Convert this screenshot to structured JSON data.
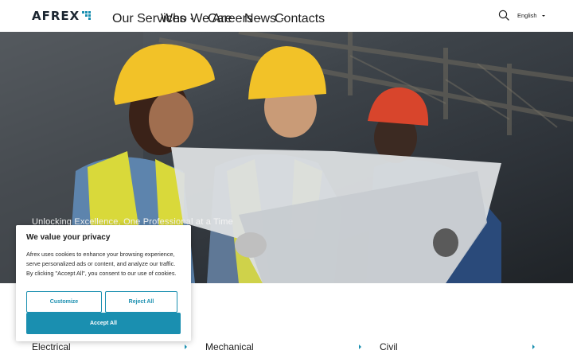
{
  "brand": {
    "name": "AFREX",
    "accent": "#1a8fb0"
  },
  "nav": {
    "items": [
      {
        "label": "Our Services",
        "has_caret": true
      },
      {
        "label": "Who We Are",
        "has_caret": false
      },
      {
        "label": "Careers",
        "has_caret": true
      },
      {
        "label": "News",
        "has_caret": true
      },
      {
        "label": "Contacts",
        "has_caret": false
      }
    ],
    "search_icon": "search-icon",
    "language": "English"
  },
  "hero": {
    "tagline": "Unlocking Excellence, One Professional at a Time"
  },
  "cookie": {
    "title": "We value your privacy",
    "body": "Afrex uses cookies to enhance your browsing experience, serve personalized ads or content, and analyze our traffic. By clicking \"Accept All\", you consent to our use of cookies.",
    "customize_label": "Customize",
    "reject_label": "Reject All",
    "accept_label": "Accept All"
  },
  "services": [
    {
      "label": "Electrical"
    },
    {
      "label": "Mechanical"
    },
    {
      "label": "Civil"
    }
  ]
}
